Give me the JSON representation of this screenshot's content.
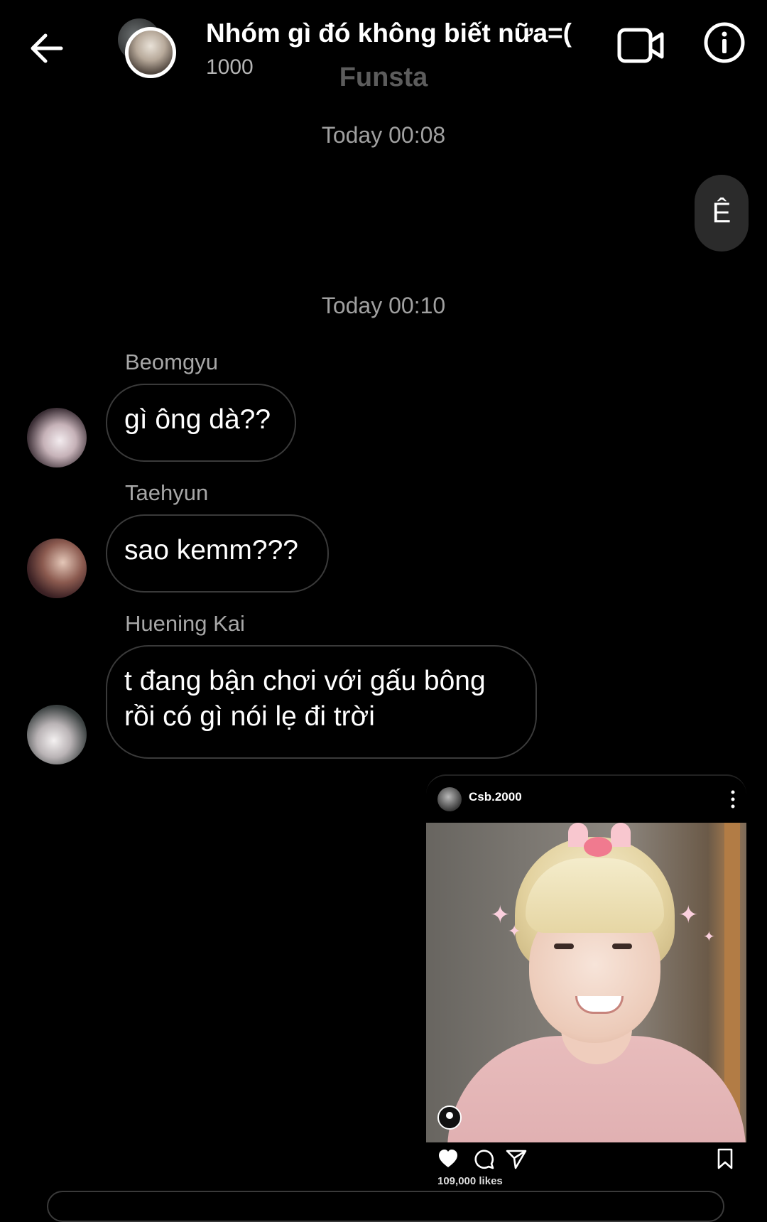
{
  "header": {
    "title": "Nhóm gì đó không biết nữa=(",
    "subtitle": "1000",
    "watermark": "Funsta",
    "back_icon": "arrow-left-icon",
    "video_icon": "video-camera-icon",
    "info_icon": "info-circle-icon"
  },
  "thread": {
    "timestamps": [
      "Today 00:08",
      "Today 00:10"
    ],
    "my_message": "Ê",
    "messages": [
      {
        "sender": "Beomgyu",
        "text": "gì ông dà??"
      },
      {
        "sender": "Taehyun",
        "text": "sao kemm???"
      },
      {
        "sender": "Huening Kai",
        "text_line1": "t đang bận chơi với gấu bông",
        "text_line2": "rồi có gì nói lẹ đi trời"
      }
    ]
  },
  "shared_post": {
    "username": "Csb.2000",
    "likes": "109,000 likes",
    "icons": [
      "heart-icon",
      "comment-icon",
      "share-icon",
      "bookmark-icon",
      "more-vertical-icon",
      "tag-user-icon"
    ]
  },
  "colors": {
    "background": "#000000",
    "bubble_border": "#3a3a3a",
    "own_bubble": "#2b2b2b",
    "secondary_text": "#a7a7a7"
  }
}
